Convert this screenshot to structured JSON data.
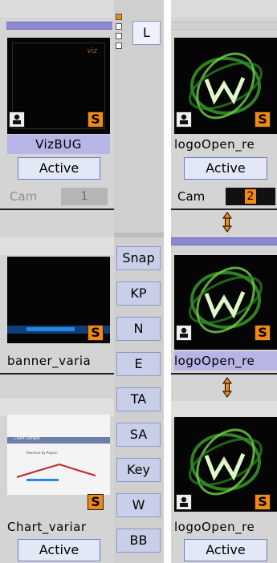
{
  "left_column": {
    "cards": [
      {
        "name": "VizBUG",
        "status": "Active",
        "cam_label": "Cam",
        "cam_number": "1",
        "thumb_mark": "viz",
        "badge": "S"
      },
      {
        "name": "banner_varia",
        "badge": "S"
      },
      {
        "name": "Chart_variar",
        "status": "Active",
        "badge": "S",
        "thumb_title": "Chart-Simple",
        "thumb_subtitle": "Revenue by Region"
      }
    ]
  },
  "middle_column": {
    "top_button": "L",
    "buttons": [
      "Snap",
      "KP",
      "N",
      "E",
      "TA",
      "SA",
      "Key",
      "W",
      "BB"
    ]
  },
  "right_column": {
    "cards": [
      {
        "name": "logoOpen_re",
        "status": "Active",
        "cam_label": "Cam",
        "cam_number": "2",
        "badge": "S"
      },
      {
        "name": "logoOpen_re",
        "badge": "S"
      },
      {
        "name": "logoOpen_re",
        "status": "Active",
        "badge": "S"
      }
    ]
  },
  "colors": {
    "accent_purple": "#8a86cf",
    "badge_orange": "#f28a12",
    "button_blue": "#c9cfe8",
    "active_button": "#e3e8f6"
  }
}
